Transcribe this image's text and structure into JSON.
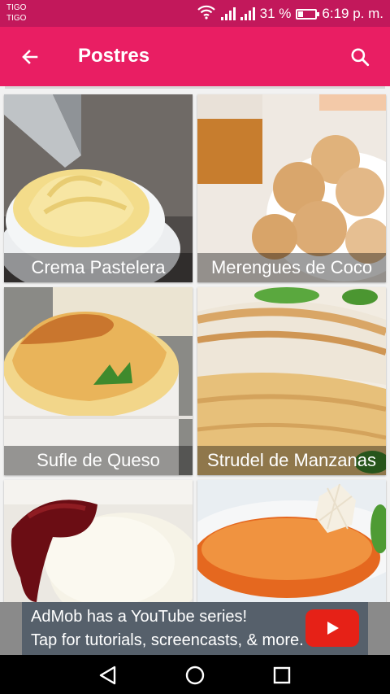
{
  "status_bar": {
    "carrier_1": "TIGO",
    "carrier_2": "TIGO",
    "battery_text": "31 %",
    "battery_level": 0.31,
    "time": "6:19 p. m."
  },
  "toolbar": {
    "title": "Postres",
    "back_icon": "arrow-back-icon",
    "search_icon": "search-icon"
  },
  "recipes": [
    {
      "caption": "Crema Pastelera"
    },
    {
      "caption": "Merengues de Coco"
    },
    {
      "caption": "Sufle de Queso"
    },
    {
      "caption": "Strudel de Manzanas"
    },
    {
      "caption": ""
    },
    {
      "caption": ""
    }
  ],
  "ad": {
    "line1": "AdMob has a YouTube series!",
    "line2": "Tap for tutorials, screencasts, & more."
  },
  "colors": {
    "status_bar": "#c2185b",
    "toolbar": "#e91e63",
    "ad_background": "#56606b",
    "youtube_red": "#e62117"
  }
}
